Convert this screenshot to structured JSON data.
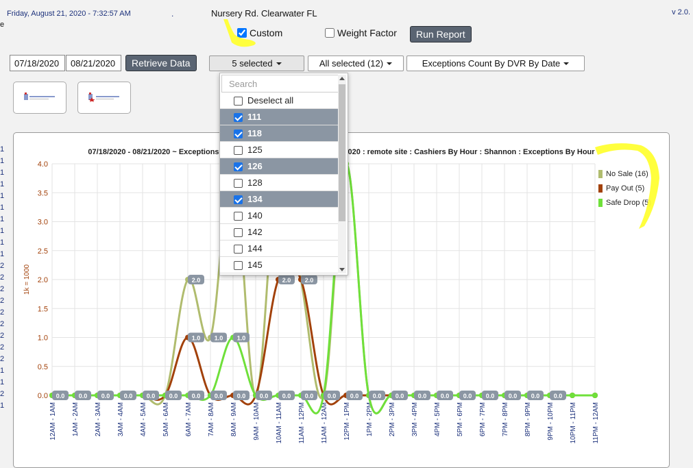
{
  "header": {
    "datetime": "Friday, August 21, 2020 - 7:32:57 AM",
    "separator": ".",
    "location": "Nursery Rd. Clearwater FL",
    "version": "v 2.0.",
    "left_edge_char": "e"
  },
  "options": {
    "custom_label": "Custom",
    "custom_checked": true,
    "weight_label": "Weight Factor",
    "weight_checked": false,
    "run_report_label": "Run Report"
  },
  "filters": {
    "start_date": "07/18/2020",
    "end_date": "08/21/2020",
    "retrieve_label": "Retrieve Data",
    "dvr_dropdown_label": "5 selected",
    "second_dropdown_label": "All selected (12)",
    "report_type_label": "Exceptions Count By DVR By Date"
  },
  "dvr_menu": {
    "search_placeholder": "Search",
    "deselect_label": "Deselect all",
    "items": [
      {
        "label": "111",
        "selected": true
      },
      {
        "label": "118",
        "selected": true
      },
      {
        "label": "125",
        "selected": false
      },
      {
        "label": "126",
        "selected": true
      },
      {
        "label": "128",
        "selected": false
      },
      {
        "label": "134",
        "selected": true
      },
      {
        "label": "140",
        "selected": false
      },
      {
        "label": "142",
        "selected": false
      },
      {
        "label": "144",
        "selected": false
      },
      {
        "label": "145",
        "selected": false
      }
    ]
  },
  "side_column": [
    "1",
    "1",
    "1",
    "1",
    "1",
    "1",
    "1",
    "1",
    "1",
    "1",
    "2",
    "2",
    "2",
    "2",
    "2",
    "2",
    "2",
    "2",
    "2",
    "1",
    "1",
    "2",
    "1"
  ],
  "chart_data": {
    "type": "line",
    "title_left": "07/18/2020 - 08/21/2020 ~ Exceptions",
    "title_right": "020 : remote site : Cashiers By Hour : Shannon : Exceptions By Hour",
    "ylabel": "1k = 1000",
    "ylim": [
      0,
      4.0
    ],
    "yticks": [
      "0.0",
      "0.5",
      "1.0",
      "1.5",
      "2.0",
      "2.5",
      "3.0",
      "3.5",
      "4.0"
    ],
    "categories": [
      "12AM - 1AM",
      "1AM - 2AM",
      "2AM - 3AM",
      "3AM - 4AM",
      "4AM - 5AM",
      "5AM - 6AM",
      "6AM - 7AM",
      "7AM - 8AM",
      "8AM - 9AM",
      "9AM - 10AM",
      "10AM - 11AM",
      "11AM - 12PM",
      "11AM - 12AM",
      "12PM - 1PM",
      "1PM - 2PM",
      "2PM - 3PM",
      "3PM - 4PM",
      "4PM - 5PM",
      "5PM - 6PM",
      "6PM - 7PM",
      "7PM - 8PM",
      "8PM - 9PM",
      "9PM - 10PM",
      "10PM - 11PM",
      "11PM - 12AM"
    ],
    "series": [
      {
        "name": "No Sale (16)",
        "color": "#b0bc6e",
        "values": [
          0,
          0,
          0,
          0,
          0,
          0,
          2,
          1,
          4,
          0,
          4,
          2,
          0,
          4,
          0,
          0,
          0,
          0,
          0,
          0,
          0,
          0,
          0,
          0,
          0
        ]
      },
      {
        "name": "Pay Out (5)",
        "color": "#a2410a",
        "values": [
          0,
          0,
          0,
          0,
          0,
          0,
          1,
          0,
          0,
          0,
          2,
          2,
          0,
          0,
          0,
          0,
          0,
          0,
          0,
          0,
          0,
          0,
          0,
          0,
          0
        ]
      },
      {
        "name": "Safe Drop (5)",
        "color": "#6fe03a",
        "values": [
          0,
          0,
          0,
          0,
          0,
          0,
          0,
          0,
          1,
          0,
          0,
          0,
          0,
          4,
          0,
          0,
          0,
          0,
          0,
          0,
          0,
          0,
          0,
          0,
          0
        ]
      }
    ],
    "data_labels": [
      {
        "index": 0,
        "value": "0.0"
      },
      {
        "index": 1,
        "value": "0.0"
      },
      {
        "index": 2,
        "value": "0.0"
      },
      {
        "index": 3,
        "value": "0.0"
      },
      {
        "index": 4,
        "value": "0.0"
      },
      {
        "index": 5,
        "value": "0.0"
      },
      {
        "index": 6,
        "value": "0.0"
      },
      {
        "index": 7,
        "value": "0.0"
      },
      {
        "index": 8,
        "value": "0.0"
      },
      {
        "index": 9,
        "value": "0.0"
      },
      {
        "index": 10,
        "value": "0.0"
      },
      {
        "index": 11,
        "value": "0.0"
      },
      {
        "index": 12,
        "value": "0.0"
      },
      {
        "index": 13,
        "value": "0.0"
      },
      {
        "index": 14,
        "value": "0.0"
      },
      {
        "index": 15,
        "value": "0.0"
      },
      {
        "index": 16,
        "value": "0.0"
      },
      {
        "index": 17,
        "value": "0.0"
      },
      {
        "index": 18,
        "value": "0.0"
      },
      {
        "index": 19,
        "value": "0.0"
      },
      {
        "index": 20,
        "value": "0.0"
      },
      {
        "index": 21,
        "value": "0.0"
      },
      {
        "index": 22,
        "value": "0.0"
      },
      {
        "index": 6,
        "value": "2.0",
        "level": 2
      },
      {
        "index": 6,
        "value": "1.0",
        "level": 1
      },
      {
        "index": 7,
        "value": "1.0",
        "level": 1
      },
      {
        "index": 8,
        "value": "1.0",
        "level": 1
      },
      {
        "index": 10,
        "value": "2.0",
        "level": 2
      },
      {
        "index": 11,
        "value": "2.0",
        "level": 2
      }
    ],
    "legend_position": "right",
    "grid": true
  },
  "colors": {
    "highlight": "#ffff33",
    "button_dark": "#5a6472",
    "selected_row": "#8b96a3"
  }
}
